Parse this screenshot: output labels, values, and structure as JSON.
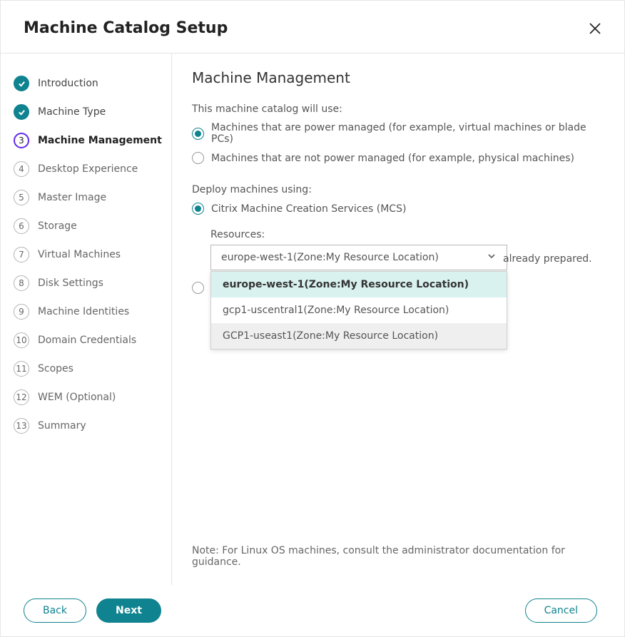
{
  "header": {
    "title": "Machine Catalog Setup"
  },
  "sidebar": {
    "steps": [
      {
        "num": "✓",
        "label": "Introduction",
        "state": "done"
      },
      {
        "num": "✓",
        "label": "Machine Type",
        "state": "done"
      },
      {
        "num": "3",
        "label": "Machine Management",
        "state": "active"
      },
      {
        "num": "4",
        "label": "Desktop Experience",
        "state": "pending"
      },
      {
        "num": "5",
        "label": "Master Image",
        "state": "pending"
      },
      {
        "num": "6",
        "label": "Storage",
        "state": "pending"
      },
      {
        "num": "7",
        "label": "Virtual Machines",
        "state": "pending"
      },
      {
        "num": "8",
        "label": "Disk Settings",
        "state": "pending"
      },
      {
        "num": "9",
        "label": "Machine Identities",
        "state": "pending"
      },
      {
        "num": "10",
        "label": "Domain Credentials",
        "state": "pending"
      },
      {
        "num": "11",
        "label": "Scopes",
        "state": "pending"
      },
      {
        "num": "12",
        "label": "WEM (Optional)",
        "state": "pending"
      },
      {
        "num": "13",
        "label": "Summary",
        "state": "pending"
      }
    ]
  },
  "main": {
    "title": "Machine Management",
    "use_label": "This machine catalog will use:",
    "power_options": {
      "managed": "Machines that are power managed (for example, virtual machines or blade PCs)",
      "not_managed": "Machines that are not power managed (for example, physical machines)"
    },
    "deploy_label": "Deploy machines using:",
    "deploy_options": {
      "mcs": "Citrix Machine Creation Services (MCS)"
    },
    "resources_label": "Resources:",
    "resources_selected": "europe-west-1(Zone:My Resource Location)",
    "resources_options": [
      "europe-west-1(Zone:My Resource Location)",
      "gcp1-uscentral1(Zone:My Resource Location)",
      "GCP1-useast1(Zone:My Resource Location)"
    ],
    "partial_text": "already prepared.",
    "note": "Note: For Linux OS machines, consult the administrator documentation for guidance."
  },
  "footer": {
    "back": "Back",
    "next": "Next",
    "cancel": "Cancel"
  }
}
